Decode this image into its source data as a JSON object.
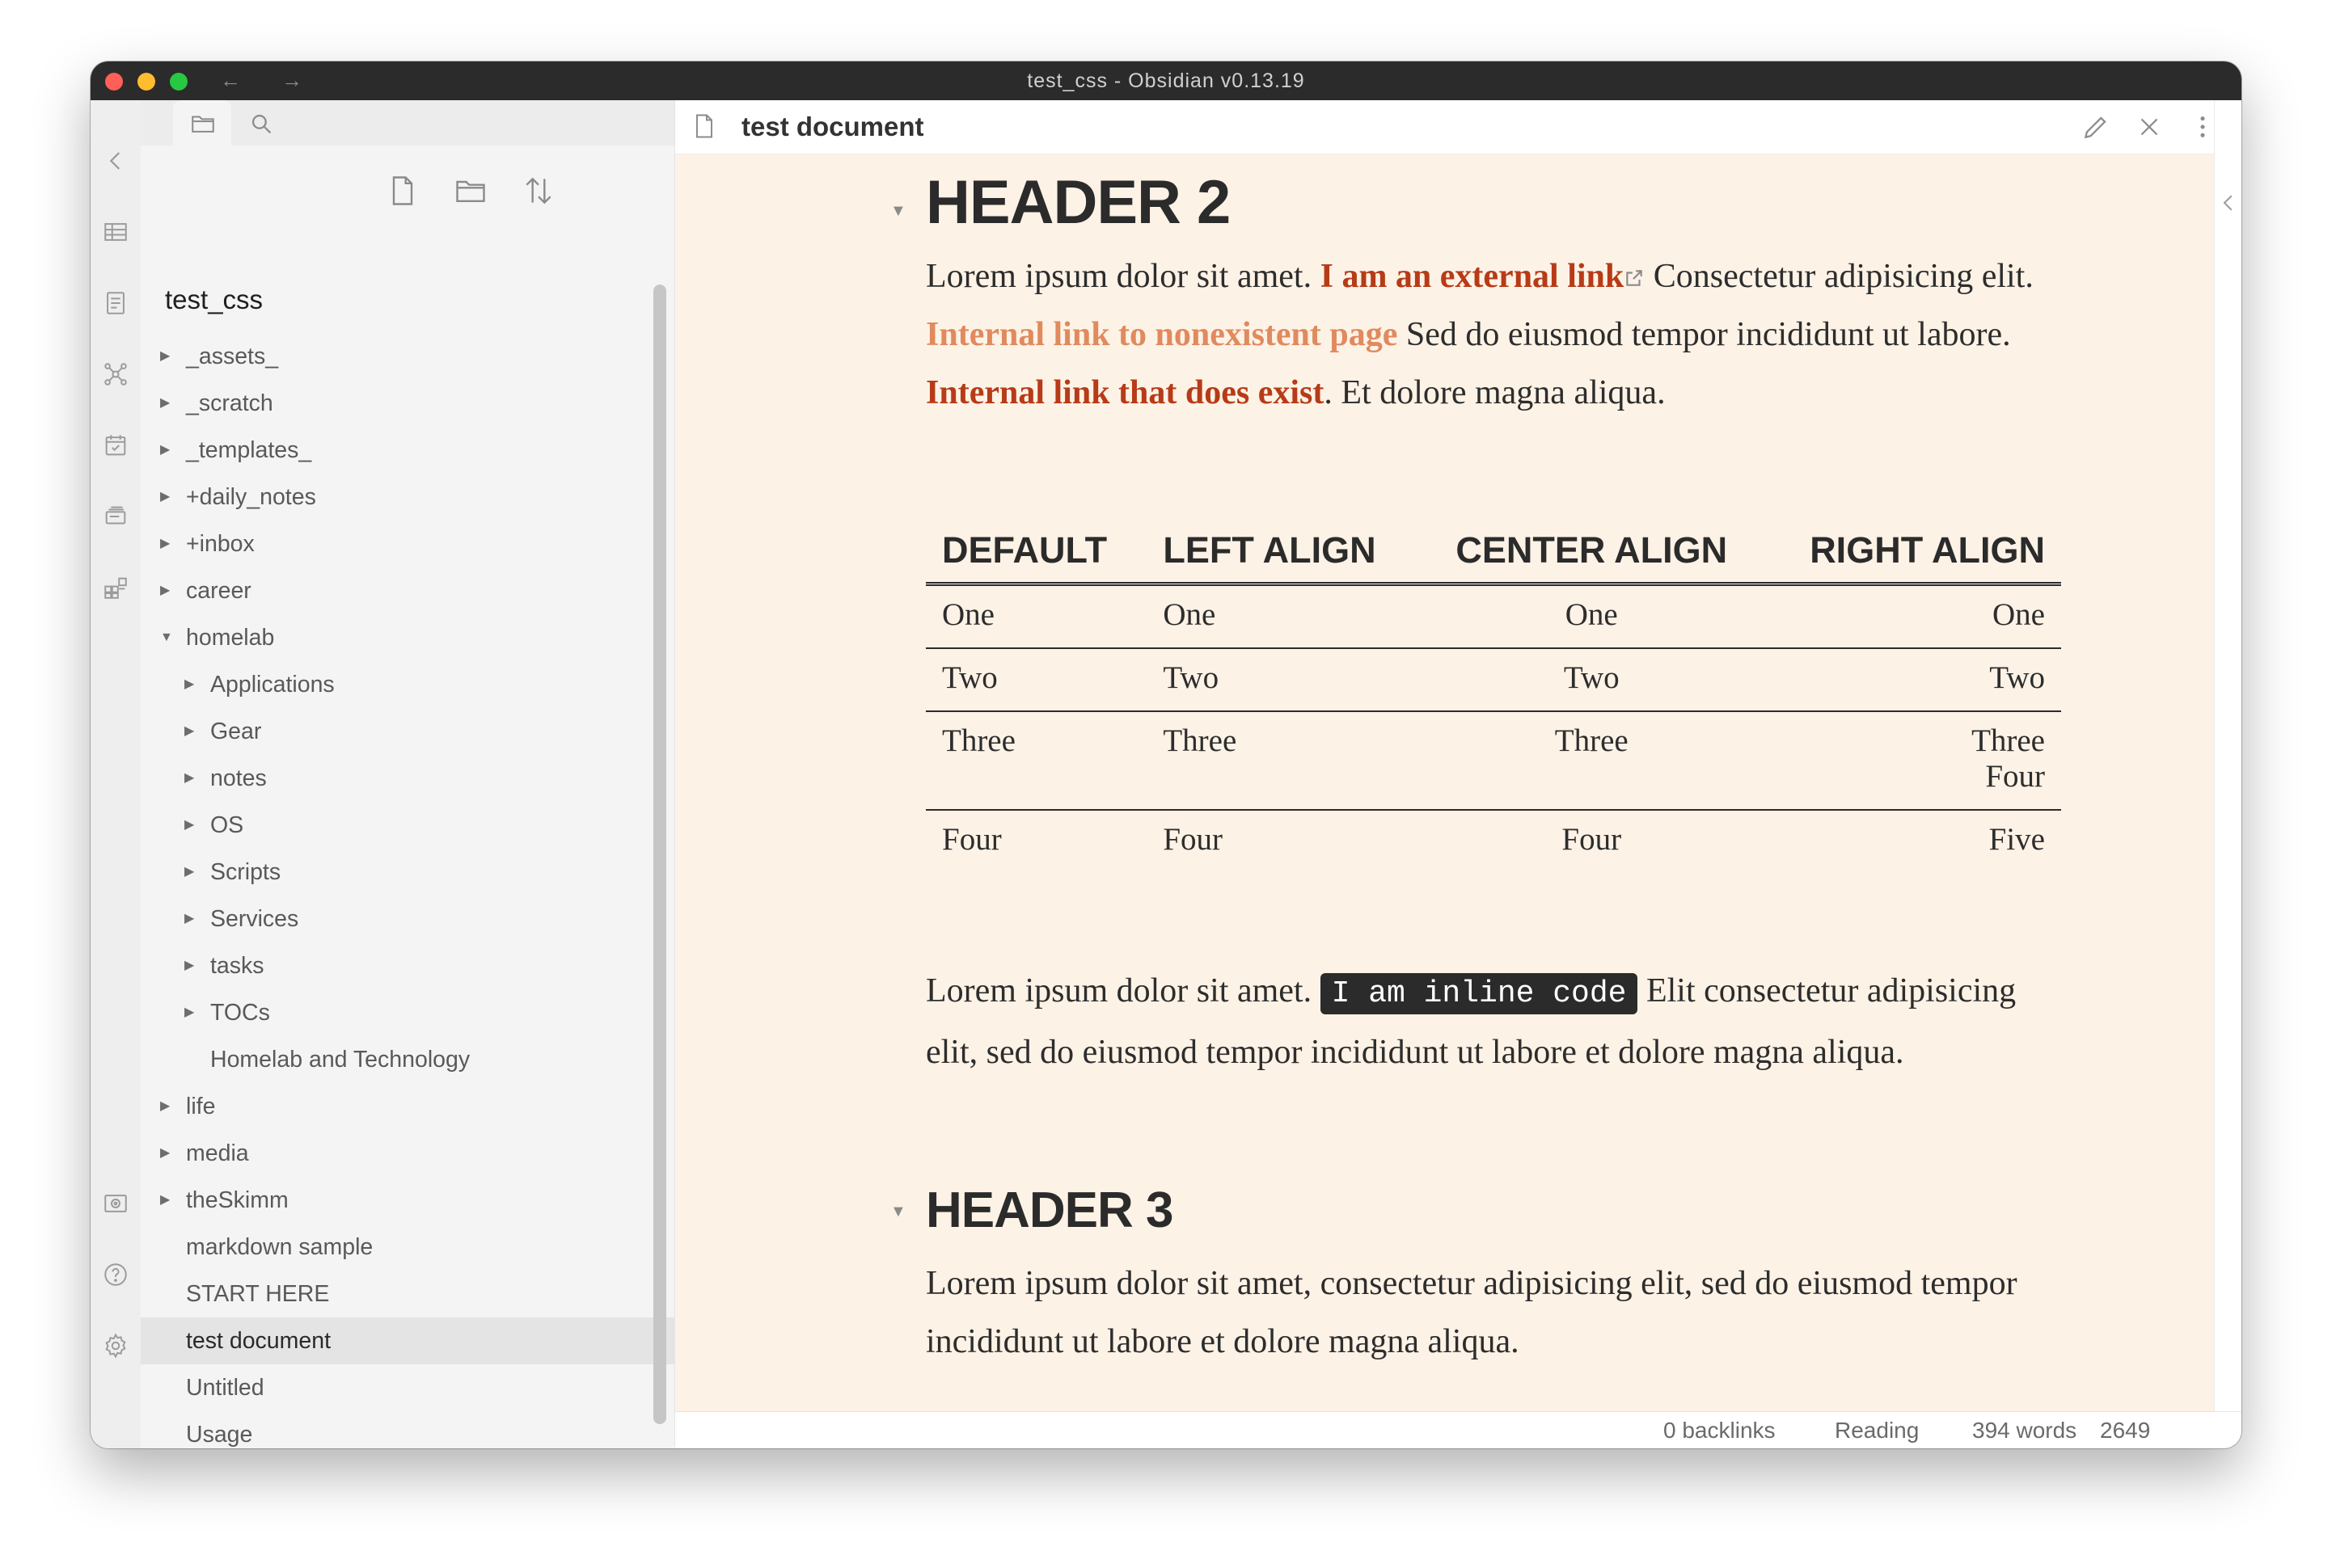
{
  "window": {
    "title": "test_css - Obsidian v0.13.19"
  },
  "explorer": {
    "vault_name": "test_css",
    "items": [
      {
        "label": "_assets_",
        "level": 0,
        "folder": true,
        "expanded": false
      },
      {
        "label": "_scratch",
        "level": 0,
        "folder": true,
        "expanded": false
      },
      {
        "label": "_templates_",
        "level": 0,
        "folder": true,
        "expanded": false
      },
      {
        "label": "+daily_notes",
        "level": 0,
        "folder": true,
        "expanded": false
      },
      {
        "label": "+inbox",
        "level": 0,
        "folder": true,
        "expanded": false
      },
      {
        "label": "career",
        "level": 0,
        "folder": true,
        "expanded": false
      },
      {
        "label": "homelab",
        "level": 0,
        "folder": true,
        "expanded": true
      },
      {
        "label": "Applications",
        "level": 1,
        "folder": true,
        "expanded": false
      },
      {
        "label": "Gear",
        "level": 1,
        "folder": true,
        "expanded": false
      },
      {
        "label": "notes",
        "level": 1,
        "folder": true,
        "expanded": false
      },
      {
        "label": "OS",
        "level": 1,
        "folder": true,
        "expanded": false
      },
      {
        "label": "Scripts",
        "level": 1,
        "folder": true,
        "expanded": false
      },
      {
        "label": "Services",
        "level": 1,
        "folder": true,
        "expanded": false
      },
      {
        "label": "tasks",
        "level": 1,
        "folder": true,
        "expanded": false
      },
      {
        "label": "TOCs",
        "level": 1,
        "folder": true,
        "expanded": false
      },
      {
        "label": "Homelab and Technology",
        "level": 1,
        "folder": false
      },
      {
        "label": "life",
        "level": 0,
        "folder": true,
        "expanded": false
      },
      {
        "label": "media",
        "level": 0,
        "folder": true,
        "expanded": false
      },
      {
        "label": "theSkimm",
        "level": 0,
        "folder": true,
        "expanded": false
      },
      {
        "label": "markdown sample",
        "level": 0,
        "folder": false
      },
      {
        "label": "START HERE",
        "level": 0,
        "folder": false
      },
      {
        "label": "test document",
        "level": 0,
        "folder": false,
        "selected": true
      },
      {
        "label": "Untitled",
        "level": 0,
        "folder": false
      },
      {
        "label": "Usage",
        "level": 0,
        "folder": false
      }
    ]
  },
  "editor": {
    "title": "test document",
    "h2": "HEADER 2",
    "p1": {
      "t1": "Lorem ipsum dolor sit amet. ",
      "external_link": "I am an external link",
      "t2": " Consectetur adipisicing elit. ",
      "unresolved_link": "Internal link to nonexistent page",
      "t3": " Sed do eiusmod tempor incididunt ut labore. ",
      "internal_link": "Internal link that does exist",
      "t4": ". Et dolore magna aliqua."
    },
    "table": {
      "headers": [
        "DEFAULT",
        "LEFT ALIGN",
        "CENTER ALIGN",
        "RIGHT ALIGN"
      ],
      "rows": [
        [
          "One",
          "One",
          "One",
          "One"
        ],
        [
          "Two",
          "Two",
          "Two",
          "Two"
        ],
        [
          "Three",
          "Three",
          "Three",
          "Three\nFour"
        ],
        [
          "Four",
          "Four",
          "Four",
          "Five"
        ]
      ]
    },
    "p2": {
      "t1": "Lorem ipsum dolor sit amet. ",
      "code": "I am inline code",
      "t2": " Elit consectetur adipisicing elit, sed do eiusmod tempor incididunt ut labore et dolore magna aliqua."
    },
    "h3": "HEADER 3",
    "p3": "Lorem ipsum dolor sit amet, consectetur adipisicing elit, sed do eiusmod tempor incididunt ut labore et dolore magna aliqua."
  },
  "status": {
    "backlinks": "0 backlinks",
    "mode": "Reading",
    "words": "394 words",
    "characters": "2649 characters"
  },
  "colors": {
    "editor_background": "#fdf2e6",
    "external_link": "#b73b17",
    "unresolved_link": "#e08a5e",
    "internal_link": "#b73b17",
    "inline_code_background": "#2b2b2b"
  },
  "icons": {
    "ribbon_top": [
      "collapse-left-icon",
      "table-icon",
      "daily-note-icon",
      "graph-icon",
      "calendar-icon",
      "cards-icon",
      "blocks-icon"
    ],
    "ribbon_bottom": [
      "vault-icon",
      "help-icon",
      "settings-icon"
    ],
    "explorer_tabs": [
      "folder-icon",
      "search-icon"
    ],
    "explorer_actions": [
      "new-note-icon",
      "new-folder-icon",
      "sort-icon"
    ],
    "editor_header": [
      "file-icon",
      "edit-pencil-icon",
      "close-icon",
      "more-options-icon"
    ]
  }
}
